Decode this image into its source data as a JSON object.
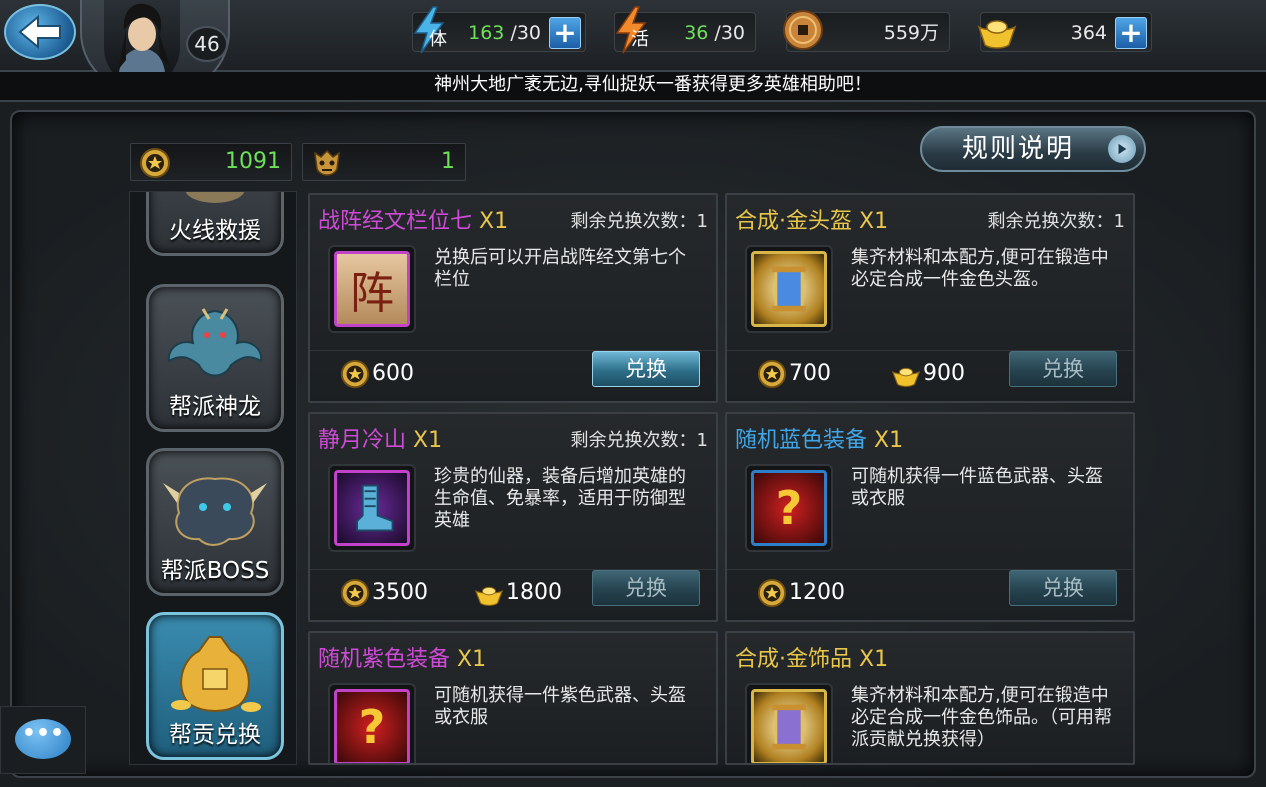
{
  "player": {
    "level": "46"
  },
  "resources": [
    {
      "name": "stamina",
      "icon": "lightning-stamina-icon",
      "glyph": "体",
      "current": "163",
      "max": " /30",
      "has_plus": true
    },
    {
      "name": "vitality",
      "icon": "lightning-vitality-icon",
      "glyph": "活",
      "current": "36",
      "max": " /30",
      "has_plus": false
    },
    {
      "name": "coins",
      "icon": "copper-coin-icon",
      "value": "559万",
      "has_plus": false
    },
    {
      "name": "gold",
      "icon": "gold-ingot-icon",
      "value": "364",
      "has_plus": true
    }
  ],
  "notice": "神州大地广袤无边,寻仙捉妖一番获得更多英雄相助吧！",
  "currencies": {
    "guild_contribution": "1091",
    "boss_token": "1"
  },
  "rules_button": "规则说明",
  "sidebar": {
    "items": [
      {
        "label": "火线救援",
        "icon": "rescue-icon"
      },
      {
        "label": "帮派神龙",
        "icon": "dragon-icon"
      },
      {
        "label": "帮派BOSS",
        "icon": "boss-icon"
      },
      {
        "label": "帮贡兑换",
        "icon": "money-bag-icon",
        "active": true
      }
    ]
  },
  "cards": [
    {
      "title": "战阵经文栏位七",
      "qty": " X1",
      "title_color": "#d04ad8",
      "remain": "剩余兑换次数：1",
      "desc": "兑换后可以开启战阵经文第七个栏位",
      "thumb_glyph": "阵",
      "thumb_border": "#c043c8",
      "cost_contribution": "600",
      "cost_gold": "",
      "button": "兑换",
      "button_enabled": true
    },
    {
      "title": "合成·金头盔",
      "qty": " X1",
      "title_color": "#e8c64a",
      "remain": "剩余兑换次数：1",
      "desc": "集齐材料和本配方,便可在锻造中必定合成一件金色头盔。",
      "thumb_glyph": "",
      "thumb_border": "#d7b64a",
      "cost_contribution": "700",
      "cost_gold": "900",
      "button": "兑换",
      "button_enabled": false
    },
    {
      "title": "静月冷山",
      "qty": " X1",
      "title_color": "#d04ad8",
      "remain": "剩余兑换次数：1",
      "desc": "珍贵的仙器，装备后增加英雄的生命值、免暴率，适用于防御型英雄",
      "thumb_glyph": "",
      "thumb_border": "#c043c8",
      "cost_contribution": "3500",
      "cost_gold": "1800",
      "button": "兑换",
      "button_enabled": false
    },
    {
      "title": "随机蓝色装备",
      "qty": " X1",
      "title_color": "#3fa6e8",
      "remain": "",
      "desc": "可随机获得一件蓝色武器、头盔或衣服",
      "thumb_glyph": "?",
      "thumb_border": "#2f7fc8",
      "cost_contribution": "1200",
      "cost_gold": "",
      "button": "兑换",
      "button_enabled": false
    },
    {
      "title": "随机紫色装备",
      "qty": " X1",
      "title_color": "#d04ad8",
      "remain": "",
      "desc": "可随机获得一件紫色武器、头盔或衣服",
      "thumb_glyph": "?",
      "thumb_border": "#c043c8",
      "cost_contribution": "",
      "cost_gold": "",
      "button": "",
      "button_enabled": false
    },
    {
      "title": "合成·金饰品",
      "qty": " X1",
      "title_color": "#e8c64a",
      "remain": "",
      "desc": "集齐材料和本配方,便可在锻造中必定合成一件金色饰品。（可用帮派贡献兑换获得）",
      "thumb_glyph": "",
      "thumb_border": "#d7b64a",
      "cost_contribution": "",
      "cost_gold": "",
      "button": "",
      "button_enabled": false
    }
  ],
  "chat_button": "•••"
}
